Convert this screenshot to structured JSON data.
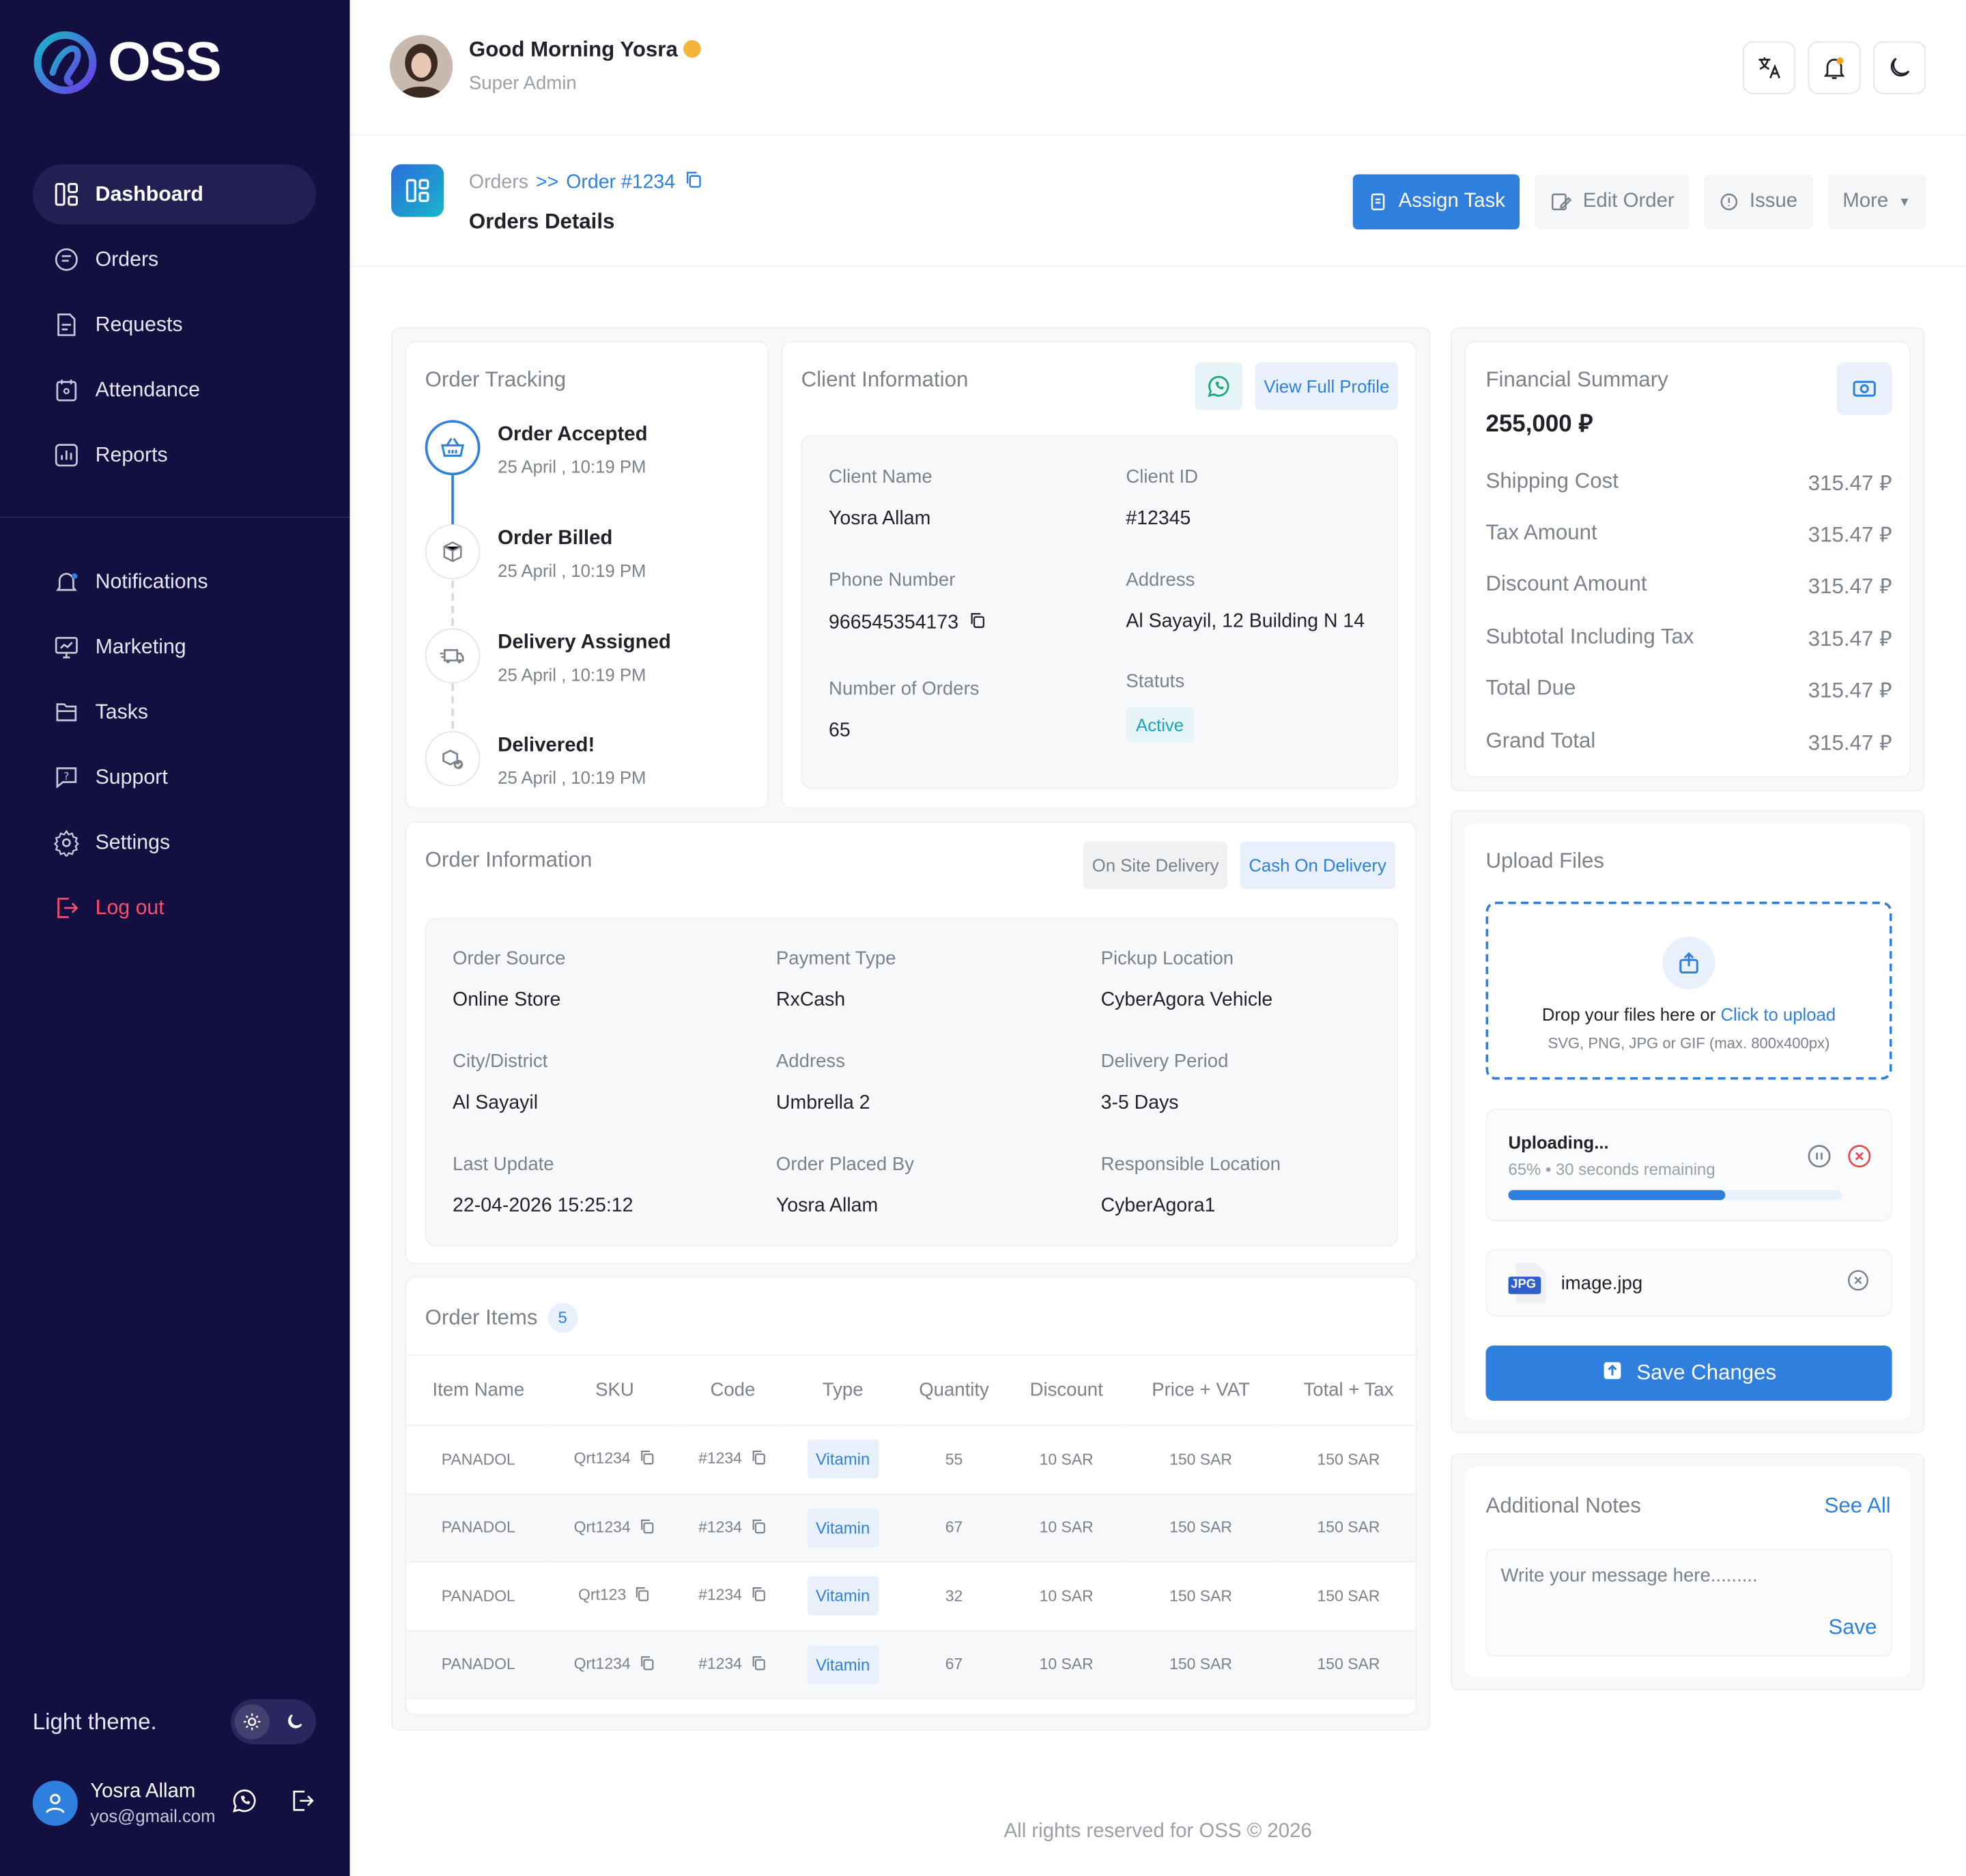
{
  "brand": {
    "name": "OSS"
  },
  "sidebar": {
    "items": [
      {
        "label": "Dashboard",
        "icon": "dashboard-icon",
        "active": true
      },
      {
        "label": "Orders",
        "icon": "orders-icon"
      },
      {
        "label": "Requests",
        "icon": "requests-icon"
      },
      {
        "label": "Attendance",
        "icon": "attendance-icon"
      },
      {
        "label": "Reports",
        "icon": "reports-icon"
      }
    ],
    "items2": [
      {
        "label": "Notifications",
        "icon": "bell-icon"
      },
      {
        "label": "Marketing",
        "icon": "marketing-icon"
      },
      {
        "label": "Tasks",
        "icon": "tasks-icon"
      },
      {
        "label": "Support",
        "icon": "support-icon"
      },
      {
        "label": "Settings",
        "icon": "gear-icon"
      },
      {
        "label": "Log out",
        "icon": "logout-icon"
      }
    ],
    "theme_label": "Light theme.",
    "user": {
      "name": "Yosra Allam",
      "email": "yos@gmail.com"
    }
  },
  "header": {
    "greeting": "Good Morning Yosra",
    "role": "Super Admin"
  },
  "breadcrumb": {
    "parent": "Orders",
    "separator": ">>",
    "current": "Order #1234"
  },
  "page": {
    "title": "Orders Details"
  },
  "actions": {
    "assign": "Assign Task",
    "edit": "Edit Order",
    "issue": "Issue",
    "more": "More"
  },
  "tracking": {
    "title": "Order Tracking",
    "steps": [
      {
        "title": "Order Accepted",
        "date": "25 April , 10:19 PM"
      },
      {
        "title": "Order Billed",
        "date": "25 April , 10:19 PM"
      },
      {
        "title": "Delivery Assigned",
        "date": "25 April , 10:19 PM"
      },
      {
        "title": "Delivered!",
        "date": "25 April , 10:19 PM"
      }
    ]
  },
  "client": {
    "title": "Client Information",
    "view_profile": "View Full Profile",
    "name_label": "Client Name",
    "name": "Yosra Allam",
    "id_label": "Client ID",
    "id": "#12345",
    "phone_label": "Phone Number",
    "phone": "966545354173",
    "address_label": "Address",
    "address": "Al Sayayil, 12 Building N 14",
    "orders_label": "Number of Orders",
    "orders": "65",
    "status_label": "Statuts",
    "status": "Active"
  },
  "order_info": {
    "title": "Order Information",
    "chip1": "On Site Delivery",
    "chip2": "Cash On Delivery",
    "fields": [
      {
        "label": "Order Source",
        "value": "Online Store"
      },
      {
        "label": "Payment Type",
        "value": "RxCash"
      },
      {
        "label": "Pickup Location",
        "value": "CyberAgora Vehicle"
      },
      {
        "label": "City/District",
        "value": "Al Sayayil"
      },
      {
        "label": "Address",
        "value": "Umbrella 2"
      },
      {
        "label": "Delivery Period",
        "value": "3-5 Days"
      },
      {
        "label": "Last Update",
        "value": "22-04-2026 15:25:12"
      },
      {
        "label": "Order Placed By",
        "value": "Yosra Allam"
      },
      {
        "label": "Responsible Location",
        "value": "CyberAgora1"
      }
    ]
  },
  "items": {
    "title": "Order Items",
    "count": "5",
    "headers": [
      "Item Name",
      "SKU",
      "Code",
      "Type",
      "Quantity",
      "Discount",
      "Price + VAT",
      "Total + Tax"
    ],
    "rows": [
      {
        "name": "PANADOL",
        "sku": "Qrt1234",
        "code": "#1234",
        "type": "Vitamin",
        "qty": "55",
        "discount": "10 SAR",
        "price": "150 SAR",
        "total": "150 SAR"
      },
      {
        "name": "PANADOL",
        "sku": "Qrt1234",
        "code": "#1234",
        "type": "Vitamin",
        "qty": "67",
        "discount": "10 SAR",
        "price": "150 SAR",
        "total": "150 SAR"
      },
      {
        "name": "PANADOL",
        "sku": "Qrt123",
        "code": "#1234",
        "type": "Vitamin",
        "qty": "32",
        "discount": "10 SAR",
        "price": "150 SAR",
        "total": "150 SAR"
      },
      {
        "name": "PANADOL",
        "sku": "Qrt1234",
        "code": "#1234",
        "type": "Vitamin",
        "qty": "67",
        "discount": "10 SAR",
        "price": "150 SAR",
        "total": "150 SAR"
      }
    ]
  },
  "financial": {
    "title": "Financial Summary",
    "total": "255,000",
    "currency": "⃁",
    "rows": [
      {
        "label": "Shipping Cost",
        "value": "315.47"
      },
      {
        "label": "Tax Amount",
        "value": "315.47"
      },
      {
        "label": "Discount Amount",
        "value": "315.47"
      },
      {
        "label": "Subtotal Including Tax",
        "value": "315.47"
      },
      {
        "label": "Total Due",
        "value": "315.47"
      },
      {
        "label": "Grand Total",
        "value": "315.47"
      }
    ]
  },
  "upload": {
    "title": "Upload Files",
    "drop_text": "Drop your files here or",
    "click_text": "Click to upload",
    "formats": "SVG, PNG, JPG or GIF (max. 800x400px)",
    "status": "Uploading...",
    "percent": "65%",
    "progress": 0.65,
    "remaining": "30 seconds remaining",
    "file_name": "image.jpg",
    "file_badge": "JPG",
    "save": "Save Changes"
  },
  "notes": {
    "title": "Additional Notes",
    "see_all": "See All",
    "placeholder": "Write your message here.........",
    "save": "Save"
  },
  "footer": "All rights reserved for OSS © 2026",
  "colors": {
    "primary": "#2f7fde",
    "sidebar": "#130f40",
    "active": "#18a7b6",
    "danger": "#ff4d6d"
  }
}
